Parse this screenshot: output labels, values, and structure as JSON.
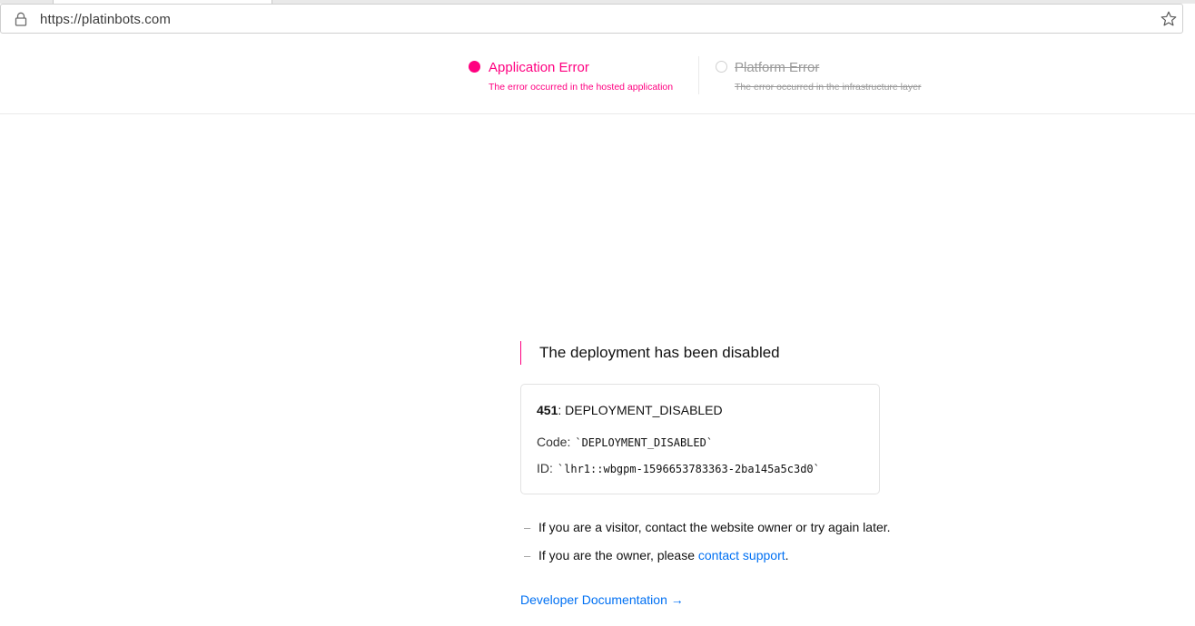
{
  "browser": {
    "url": "https://platinbots.com",
    "icons": {
      "lock": "lock-icon",
      "bookmark": "star-icon"
    }
  },
  "error_types": {
    "application": {
      "title": "Application Error",
      "subtitle": "The error occurred in the hosted application",
      "active": true
    },
    "platform": {
      "title": "Platform Error",
      "subtitle": "The error occurred in the infrastructure layer",
      "active": false
    }
  },
  "main": {
    "headline": "The deployment has been disabled",
    "error_card": {
      "status_code": "451",
      "status_text": ": DEPLOYMENT_DISABLED",
      "code_label": "Code:",
      "code_value": "`DEPLOYMENT_DISABLED`",
      "id_label": "ID:",
      "id_value": "`lhr1::wbgpm-1596653783363-2ba145a5c3d0`"
    },
    "hints": [
      {
        "dash": "–",
        "text": "If you are a visitor, contact the website owner or try again later."
      },
      {
        "dash": "–",
        "text_before": "If you are the owner, please ",
        "link": "contact support",
        "text_after": "."
      }
    ],
    "developer_docs": "Developer Documentation →"
  },
  "colors": {
    "accent": "#ff0080",
    "link": "#0070f3",
    "muted": "#9a9a9a"
  }
}
